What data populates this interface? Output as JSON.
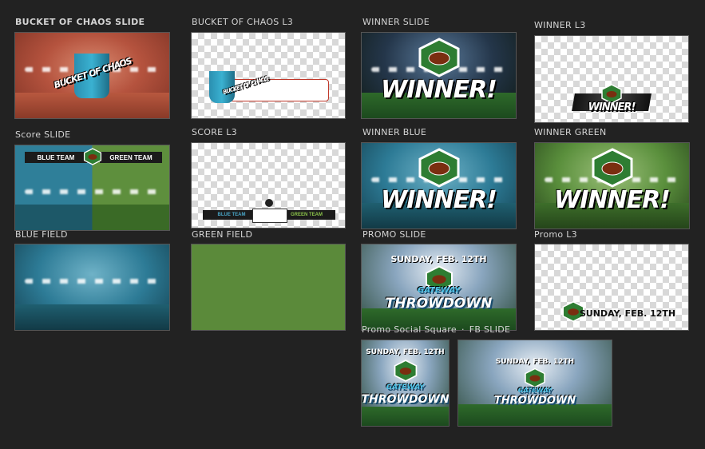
{
  "tiles": [
    {
      "label": "BUCKET OF CHAOS SLIDE",
      "graphic": "BUCKET OF CHAOS"
    },
    {
      "label": "BUCKET OF CHAOS L3",
      "graphic": "BUCKET OF CHAOS"
    },
    {
      "label": "WINNER SLIDE",
      "graphic": "WINNER!"
    },
    {
      "label": "WINNER L3",
      "graphic": "WINNER!"
    },
    {
      "label": "Score SLIDE",
      "left_team": "BLUE TEAM",
      "right_team": "GREEN TEAM"
    },
    {
      "label": "SCORE L3",
      "left_team": "BLUE TEAM",
      "right_team": "GREEN TEAM"
    },
    {
      "label": "WINNER BLUE",
      "graphic": "WINNER!"
    },
    {
      "label": "WINNER GREEN",
      "graphic": "WINNER!"
    },
    {
      "label": "BLUE FIELD"
    },
    {
      "label": "GREEN FIELD"
    },
    {
      "label": "PROMO SLIDE",
      "date": "SUNDAY, FEB. 12TH",
      "logo_top": "GATEWAY",
      "logo_bottom": "THROWDOWN"
    },
    {
      "label": "Promo L3",
      "date": "SUNDAY, FEB. 12TH"
    },
    {
      "label": "Promo Social Square",
      "date": "SUNDAY, FEB. 12TH",
      "logo_top": "GATEWAY",
      "logo_bottom": "THROWDOWN"
    },
    {
      "label": "FB SLIDE",
      "date": "SUNDAY, FEB. 12TH",
      "logo_top": "GATEWAY",
      "logo_bottom": "THROWDOWN"
    }
  ]
}
